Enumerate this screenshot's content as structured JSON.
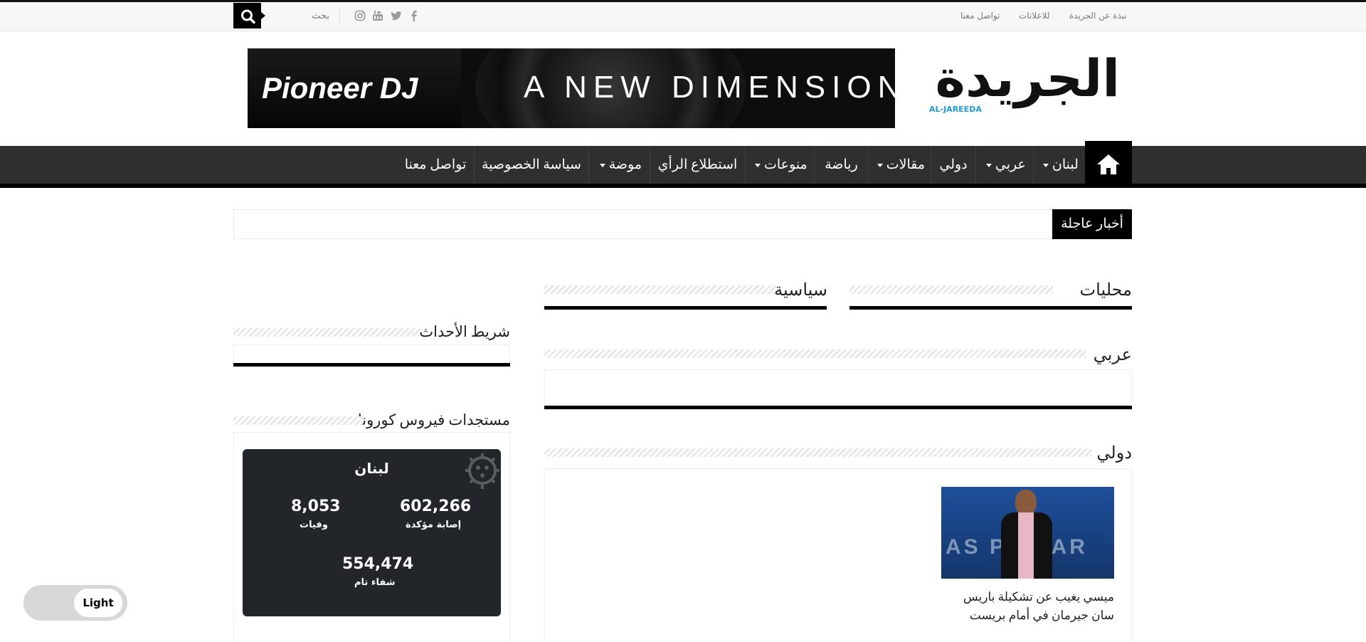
{
  "topbar": {
    "links": [
      "نبذة عن الجريدة",
      "للاعلانات",
      "تواصل معنا"
    ],
    "search_placeholder": "بحث",
    "social_icons": [
      "facebook-icon",
      "twitter-icon",
      "youtube-icon",
      "instagram-icon"
    ]
  },
  "header": {
    "logo_text": "الجريدة",
    "logo_subtext": "AL-JAREEDA",
    "banner": {
      "brand": "Pioneer DJ",
      "tagline": "A NEW DIMENSION"
    }
  },
  "nav": {
    "items": [
      {
        "label": "لبنان",
        "dropdown": true
      },
      {
        "label": "عربي",
        "dropdown": true
      },
      {
        "label": "دولي",
        "dropdown": false
      },
      {
        "label": "مقالات",
        "dropdown": true
      },
      {
        "label": "رياضة",
        "dropdown": false
      },
      {
        "label": "منوعات",
        "dropdown": true
      },
      {
        "label": "استطلاع الرأي",
        "dropdown": false
      },
      {
        "label": "موضة",
        "dropdown": true
      },
      {
        "label": "سياسة الخصوصية",
        "dropdown": false
      },
      {
        "label": "تواصل معنا",
        "dropdown": false
      }
    ]
  },
  "breaking": {
    "label": "أخبار عاجلة"
  },
  "sections": {
    "local": "محليات",
    "politics": "سياسية",
    "arab": "عربي",
    "international": "دولي",
    "events_ticker": "شريط الأحداث",
    "corona": "مستجدات فيروس كورونا"
  },
  "corona": {
    "country": "لبنان",
    "confirmed": "602,266",
    "confirmed_label": "إصابة مؤكدة",
    "deaths": "8,053",
    "deaths_label": "وفيات",
    "recovered": "554,474",
    "recovered_label": "شفاء تام"
  },
  "news": {
    "title": "ميسي يغيب عن تشكيلة باريس سان جيرمان في أمام بريست",
    "image_text": "AS PSG AR"
  },
  "theme_toggle": {
    "label": "Light"
  },
  "colors": {
    "nav_bg": "#2f2f2f",
    "accent": "#000000",
    "covid_card": "#22262a",
    "logo_blue": "#1e9ad6"
  }
}
